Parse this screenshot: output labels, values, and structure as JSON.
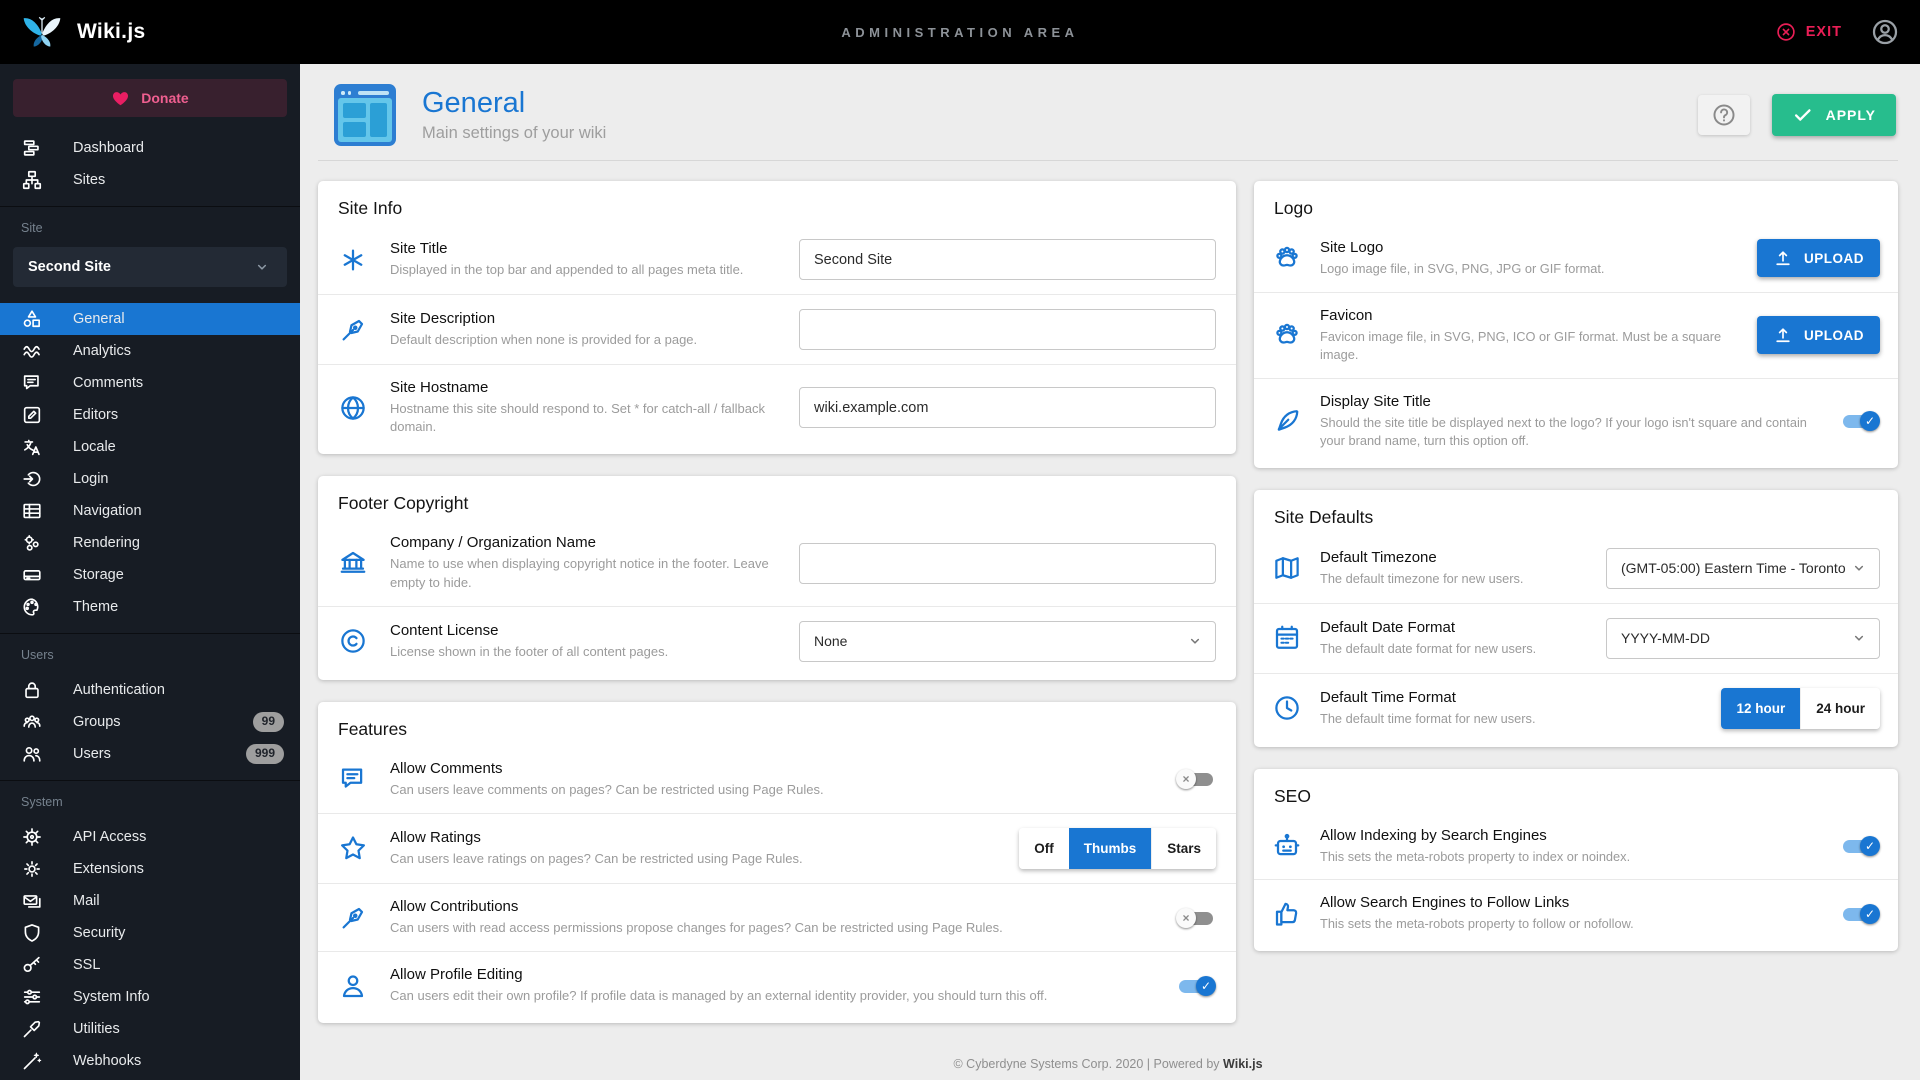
{
  "topbar": {
    "brand": "Wiki.js",
    "title": "ADMINISTRATION AREA",
    "exit_label": "EXIT",
    "exit_icon": "x-circle-icon",
    "account_icon": "account-icon",
    "logo_icon": "butterfly-logo-icon"
  },
  "sidebar": {
    "donate": {
      "label": "Donate",
      "icon": "heart-icon"
    },
    "top_items": [
      {
        "label": "Dashboard",
        "icon": "dashboard-icon"
      },
      {
        "label": "Sites",
        "icon": "sitemap-icon"
      }
    ],
    "site_section": {
      "label": "Site",
      "selector_value": "Second Site",
      "items": [
        {
          "label": "General",
          "icon": "shapes-icon",
          "active": true
        },
        {
          "label": "Analytics",
          "icon": "chart-wave-icon"
        },
        {
          "label": "Comments",
          "icon": "comment-icon"
        },
        {
          "label": "Editors",
          "icon": "pencil-box-icon"
        },
        {
          "label": "Locale",
          "icon": "translate-icon"
        },
        {
          "label": "Login",
          "icon": "login-icon"
        },
        {
          "label": "Navigation",
          "icon": "table-icon"
        },
        {
          "label": "Rendering",
          "icon": "gears-icon"
        },
        {
          "label": "Storage",
          "icon": "storage-icon"
        },
        {
          "label": "Theme",
          "icon": "palette-icon"
        }
      ]
    },
    "users_section": {
      "label": "Users",
      "items": [
        {
          "label": "Authentication",
          "icon": "lock-icon"
        },
        {
          "label": "Groups",
          "icon": "group-icon",
          "badge": "99"
        },
        {
          "label": "Users",
          "icon": "two-users-icon",
          "badge": "999"
        }
      ]
    },
    "system_section": {
      "label": "System",
      "items": [
        {
          "label": "API Access",
          "icon": "helm-icon"
        },
        {
          "label": "Extensions",
          "icon": "cog-icon"
        },
        {
          "label": "Mail",
          "icon": "mail-icon"
        },
        {
          "label": "Security",
          "icon": "shield-icon"
        },
        {
          "label": "SSL",
          "icon": "key-icon"
        },
        {
          "label": "System Info",
          "icon": "tune-icon"
        },
        {
          "label": "Utilities",
          "icon": "screwdriver-icon"
        },
        {
          "label": "Webhooks",
          "icon": "wand-icon"
        }
      ]
    }
  },
  "header": {
    "title": "General",
    "subtitle": "Main settings of your wiki",
    "apply_label": "APPLY",
    "page_icon": "browser-window-icon",
    "help_icon": "question-icon"
  },
  "cards": {
    "site_info": {
      "title": "Site Info",
      "rows": [
        {
          "icon": "asterisk-icon",
          "label": "Site Title",
          "desc": "Displayed in the top bar and appended to all pages meta title.",
          "value": "Second Site"
        },
        {
          "icon": "pen-icon",
          "label": "Site Description",
          "desc": "Default description when none is provided for a page.",
          "value": ""
        },
        {
          "icon": "globe-icon",
          "label": "Site Hostname",
          "desc": "Hostname this site should respond to. Set * for catch-all / fallback domain.",
          "value": "wiki.example.com"
        }
      ]
    },
    "footer_copyright": {
      "title": "Footer Copyright",
      "rows": [
        {
          "icon": "bank-icon",
          "label": "Company / Organization Name",
          "desc": "Name to use when displaying copyright notice in the footer. Leave empty to hide.",
          "value": ""
        },
        {
          "icon": "copyright-icon",
          "label": "Content License",
          "desc": "License shown in the footer of all content pages.",
          "value": "None"
        }
      ]
    },
    "features": {
      "title": "Features",
      "rows": [
        {
          "icon": "comment-icon",
          "label": "Allow Comments",
          "desc": "Can users leave comments on pages? Can be restricted using Page Rules.",
          "control": "toggle",
          "state": "off"
        },
        {
          "icon": "star-icon",
          "label": "Allow Ratings",
          "desc": "Can users leave ratings on pages? Can be restricted using Page Rules.",
          "control": "segmented",
          "options": [
            "Off",
            "Thumbs",
            "Stars"
          ],
          "selected": "Thumbs"
        },
        {
          "icon": "pen-icon",
          "label": "Allow Contributions",
          "desc": "Can users with read access permissions propose changes for pages? Can be restricted using Page Rules.",
          "control": "toggle",
          "state": "off"
        },
        {
          "icon": "person-icon",
          "label": "Allow Profile Editing",
          "desc": "Can users edit their own profile? If profile data is managed by an external identity provider, you should turn this off.",
          "control": "toggle",
          "state": "on"
        }
      ]
    },
    "logo": {
      "title": "Logo",
      "rows": [
        {
          "icon": "paw-icon",
          "label": "Site Logo",
          "desc": "Logo image file, in SVG, PNG, JPG or GIF format.",
          "button": "UPLOAD"
        },
        {
          "icon": "paw-icon",
          "label": "Favicon",
          "desc": "Favicon image file, in SVG, PNG, ICO or GIF format. Must be a square image.",
          "button": "UPLOAD"
        },
        {
          "icon": "quill-icon",
          "label": "Display Site Title",
          "desc": "Should the site title be displayed next to the logo? If your logo isn't square and contain your brand name, turn this option off.",
          "control": "toggle",
          "state": "on"
        }
      ]
    },
    "site_defaults": {
      "title": "Site Defaults",
      "rows": [
        {
          "icon": "map-icon",
          "label": "Default Timezone",
          "desc": "The default timezone for new users.",
          "value": "(GMT-05:00) Eastern Time - Toronto"
        },
        {
          "icon": "calendar-icon",
          "label": "Default Date Format",
          "desc": "The default date format for new users.",
          "value": "YYYY-MM-DD"
        },
        {
          "icon": "clock-icon",
          "label": "Default Time Format",
          "desc": "The default time format for new users.",
          "control": "segmented",
          "options": [
            "12 hour",
            "24 hour"
          ],
          "selected": "12 hour"
        }
      ]
    },
    "seo": {
      "title": "SEO",
      "rows": [
        {
          "icon": "robot-icon",
          "label": "Allow Indexing by Search Engines",
          "desc": "This sets the meta-robots property to index or noindex.",
          "control": "toggle",
          "state": "on"
        },
        {
          "icon": "thumb-up-icon",
          "label": "Allow Search Engines to Follow Links",
          "desc": "This sets the meta-robots property to follow or nofollow.",
          "control": "toggle",
          "state": "on"
        }
      ]
    }
  },
  "footer": {
    "text": "© Cyberdyne Systems Corp. 2020 | Powered by",
    "brand": "Wiki.js"
  },
  "colors": {
    "accent_blue": "#1976d2",
    "apply_green": "#27bd8d",
    "exit_pink": "#ea1e56",
    "donate_pink": "#e91e63",
    "topbar_bg": "#000000",
    "sidebar_bg": "#171c24",
    "content_bg": "#ededed",
    "toggle_on_track": "#7db8ed",
    "toggle_off_track": "#8f8f8f"
  }
}
